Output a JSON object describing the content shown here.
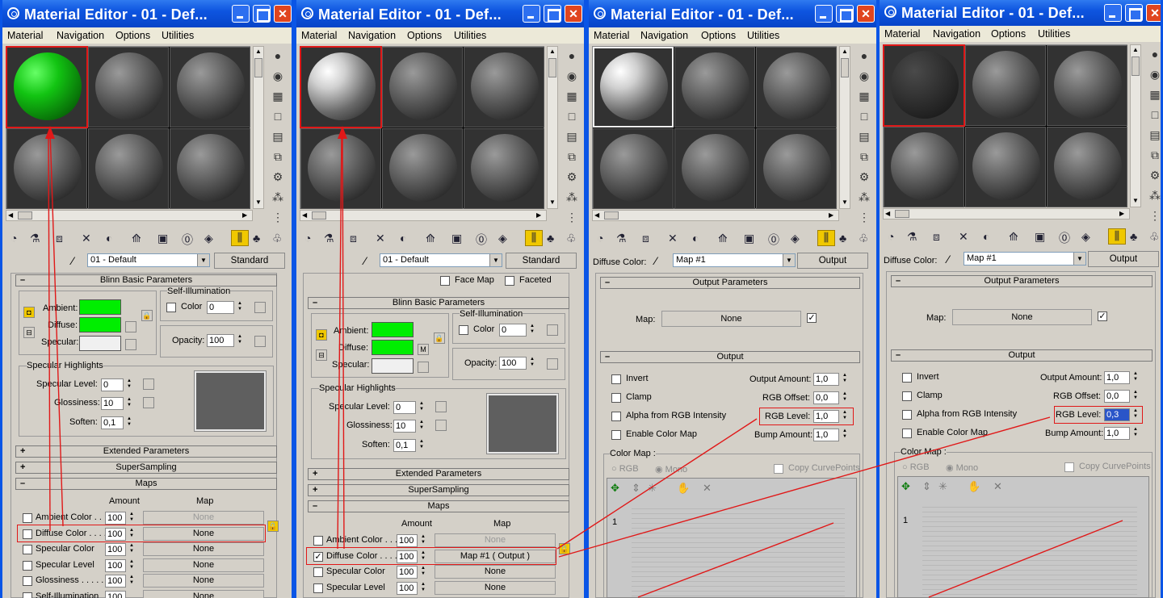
{
  "windows": [
    {
      "title": "Material Editor - 01 - Def...",
      "type_label": "Standard",
      "name_value": "01 - Default"
    },
    {
      "title": "Material Editor - 01 - Def...",
      "type_label": "Standard",
      "name_value": "01 - Default"
    },
    {
      "title": "Material Editor - 01 - Def...",
      "type_label": "Output",
      "name_value": "Map #1",
      "slot_label": "Diffuse Color:"
    },
    {
      "title": "Material Editor - 01 - Def...",
      "type_label": "Output",
      "name_value": "Map #1",
      "slot_label": "Diffuse Color:"
    }
  ],
  "menu": [
    "Material",
    "Navigation",
    "Options",
    "Utilities"
  ],
  "blinn": {
    "header": "Blinn Basic Parameters",
    "self_illum": "Self-Illumination",
    "color_label": "Color",
    "color_value": "0",
    "ambient": "Ambient:",
    "diffuse": "Diffuse:",
    "specular": "Specular:",
    "opacity": "Opacity:",
    "opacity_value": "100",
    "spec_group": "Specular Highlights",
    "spec_level": "Specular Level:",
    "spec_level_value": "0",
    "gloss": "Glossiness:",
    "gloss_value": "10",
    "soften": "Soften:",
    "soften_value": "0,1",
    "m_label": "M",
    "face_map": "Face Map",
    "faceted": "Faceted"
  },
  "rollouts": {
    "extended": "Extended Parameters",
    "supersampling": "SuperSampling",
    "maps": "Maps",
    "amount": "Amount",
    "map": "Map"
  },
  "maps_rows": [
    {
      "label": "Ambient Color . . .",
      "amount": "100",
      "map": "None"
    },
    {
      "label": "Diffuse Color . . . .",
      "amount": "100",
      "map": "None"
    },
    {
      "label": "Specular Color",
      "amount": "100",
      "map": "None"
    },
    {
      "label": "Specular Level",
      "amount": "100",
      "map": "None"
    },
    {
      "label": "Glossiness . . . . .",
      "amount": "100",
      "map": "None"
    },
    {
      "label": "Self-Illumination",
      "amount": "100",
      "map": "None"
    }
  ],
  "diffuse_map_label": "Map #1  ( Output )",
  "output": {
    "params_header": "Output Parameters",
    "map_label": "Map:",
    "map_value": "None",
    "output_header": "Output",
    "invert": "Invert",
    "clamp": "Clamp",
    "alpha": "Alpha from RGB Intensity",
    "enable_cm": "Enable Color Map",
    "out_amount": "Output Amount:",
    "out_amount_value": "1,0",
    "rgb_offset": "RGB Offset:",
    "rgb_offset_value": "0,0",
    "rgb_level": "RGB Level:",
    "rgb_level_value_a": "1,0",
    "rgb_level_value_b": "0,3",
    "bump": "Bump Amount:",
    "bump_value": "1,0",
    "color_map": "Color Map :",
    "rgb": "RGB",
    "mono": "Mono",
    "copy_cp": "Copy CurvePoints",
    "curve_tick": "1"
  },
  "colors": {
    "green_swatch": "#00ee00",
    "title_blue": "#0a55e6",
    "highlight_red": "#e01818"
  }
}
